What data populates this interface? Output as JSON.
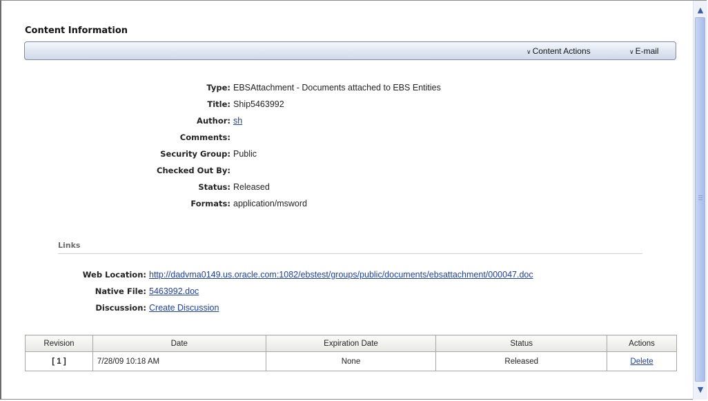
{
  "section_title": "Content Information",
  "toolbar": {
    "content_actions": "Content Actions",
    "email": "E-mail"
  },
  "properties": [
    {
      "label": "Type:",
      "value": "EBSAttachment - Documents attached to EBS Entities"
    },
    {
      "label": "Title:",
      "value": "Ship5463992"
    },
    {
      "label": "Author:",
      "value": "sh"
    },
    {
      "label": "Comments:",
      "value": ""
    },
    {
      "label": "Security Group:",
      "value": "Public"
    },
    {
      "label": "Checked Out By:",
      "value": ""
    },
    {
      "label": "Status:",
      "value": "Released"
    },
    {
      "label": "Formats:",
      "value": "application/msword"
    }
  ],
  "links": {
    "heading": "Links",
    "web_location": {
      "label": "Web Location:",
      "value": "http://dadvma0149.us.oracle.com:1082/ebstest/groups/public/documents/ebsattachment/000047.doc"
    },
    "native_file": {
      "label": "Native File:",
      "value": "5463992.doc"
    },
    "discussion": {
      "label": "Discussion:",
      "value": "Create Discussion"
    }
  },
  "revisions": {
    "columns": [
      "Revision",
      "Date",
      "Expiration Date",
      "Status",
      "Actions"
    ],
    "rows": [
      {
        "revision": "[ 1 ]",
        "date": "7/28/09 10:18 AM",
        "expiration": "None",
        "status": "Released",
        "action": "Delete"
      }
    ]
  },
  "icons": {
    "scroll_up": "scroll-up-arrow-icon",
    "scroll_down": "scroll-down-arrow-icon",
    "dropdown": "chevron-down-icon"
  },
  "colors": {
    "link": "#1c3fa8",
    "toolbar": "#dfe6f2"
  }
}
